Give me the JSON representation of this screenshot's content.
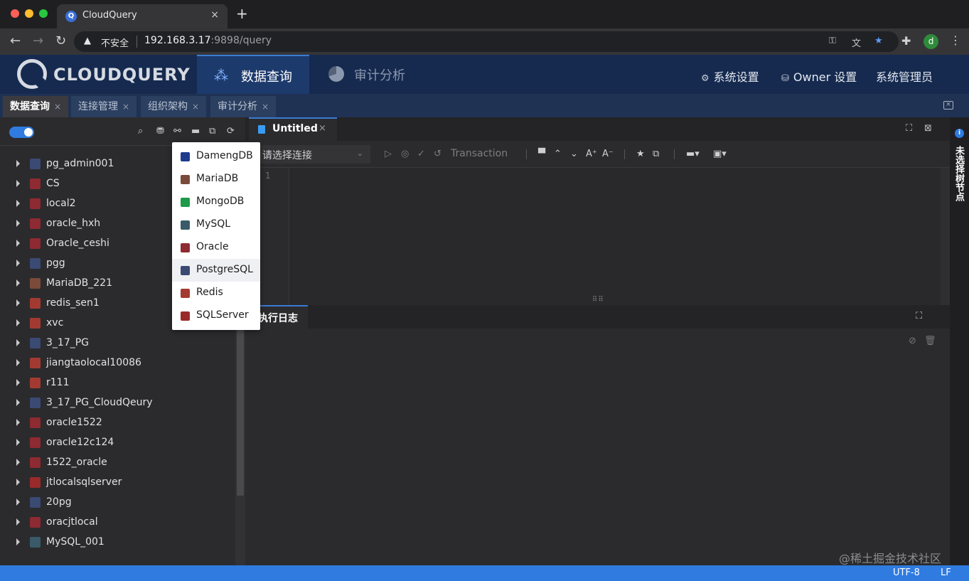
{
  "browser": {
    "tab_title": "CloudQuery",
    "tab_close": "×",
    "new_tab": "+",
    "security_label": "不安全",
    "url_host": "192.168.3.17",
    "url_path": ":9898/query"
  },
  "app": {
    "logo_text": "CLOUDQUERY",
    "nav": {
      "query": "数据查询",
      "audit": "审计分析"
    },
    "header_right": {
      "system_settings": "系统设置",
      "owner_settings": "Owner 设置",
      "sys_admin": "系统管理员"
    }
  },
  "module_tabs": [
    {
      "label": "数据查询",
      "active": true
    },
    {
      "label": "连接管理",
      "active": false
    },
    {
      "label": "组织架构",
      "active": false
    },
    {
      "label": "审计分析",
      "active": false
    }
  ],
  "tree": {
    "connections": [
      {
        "label": "pg_admin001",
        "type": "postgresql"
      },
      {
        "label": "CS",
        "type": "oracle"
      },
      {
        "label": "local2",
        "type": "oracle"
      },
      {
        "label": "oracle_hxh",
        "type": "oracle"
      },
      {
        "label": "Oracle_ceshi",
        "type": "oracle"
      },
      {
        "label": "pgg",
        "type": "postgresql"
      },
      {
        "label": "MariaDB_221",
        "type": "mariadb"
      },
      {
        "label": "redis_sen1",
        "type": "redis"
      },
      {
        "label": "xvc",
        "type": "redis"
      },
      {
        "label": "3_17_PG",
        "type": "postgresql"
      },
      {
        "label": "jiangtaolocal10086",
        "type": "redis"
      },
      {
        "label": "r111",
        "type": "redis"
      },
      {
        "label": "3_17_PG_CloudQeury",
        "type": "postgresql"
      },
      {
        "label": "oracle1522",
        "type": "oracle"
      },
      {
        "label": "oracle12c124",
        "type": "oracle"
      },
      {
        "label": "1522_oracle",
        "type": "oracle"
      },
      {
        "label": "jtlocalsqlserver",
        "type": "sqlserver"
      },
      {
        "label": "20pg",
        "type": "postgresql"
      },
      {
        "label": "oracjtlocal",
        "type": "oracle"
      },
      {
        "label": "MySQL_001",
        "type": "mysql"
      }
    ]
  },
  "db_menu": {
    "items": [
      {
        "label": "DamengDB",
        "type": "dameng"
      },
      {
        "label": "MariaDB",
        "type": "mariadb"
      },
      {
        "label": "MongoDB",
        "type": "mongodb"
      },
      {
        "label": "MySQL",
        "type": "mysql"
      },
      {
        "label": "Oracle",
        "type": "oracle"
      },
      {
        "label": "PostgreSQL",
        "type": "postgresql",
        "hover": true
      },
      {
        "label": "Redis",
        "type": "redis"
      },
      {
        "label": "SQLServer",
        "type": "sqlserver"
      }
    ]
  },
  "editor": {
    "tab_label": "Untitled",
    "tab_close": "×",
    "connection_placeholder": "请选择连接",
    "transaction_label": "Transaction",
    "line_number": "1",
    "log_tab": "执行日志"
  },
  "right_rail": {
    "label": "未选择树节点"
  },
  "statusbar": {
    "encoding": "UTF-8",
    "line_ending": "LF"
  },
  "watermark": "@稀土掘金技术社区",
  "colors": {
    "accent": "#2f7be0",
    "header_bg": "#162a4f",
    "panel_bg": "#2b2b2d",
    "postgresql": "#3b4a73",
    "oracle": "#8e2a31",
    "mariadb": "#7a4a3a",
    "redis": "#a33a32",
    "sqlserver": "#9a2a2a",
    "mysql": "#3a5a6a",
    "mongodb": "#1e9a4a",
    "dameng": "#1d3a8c"
  }
}
